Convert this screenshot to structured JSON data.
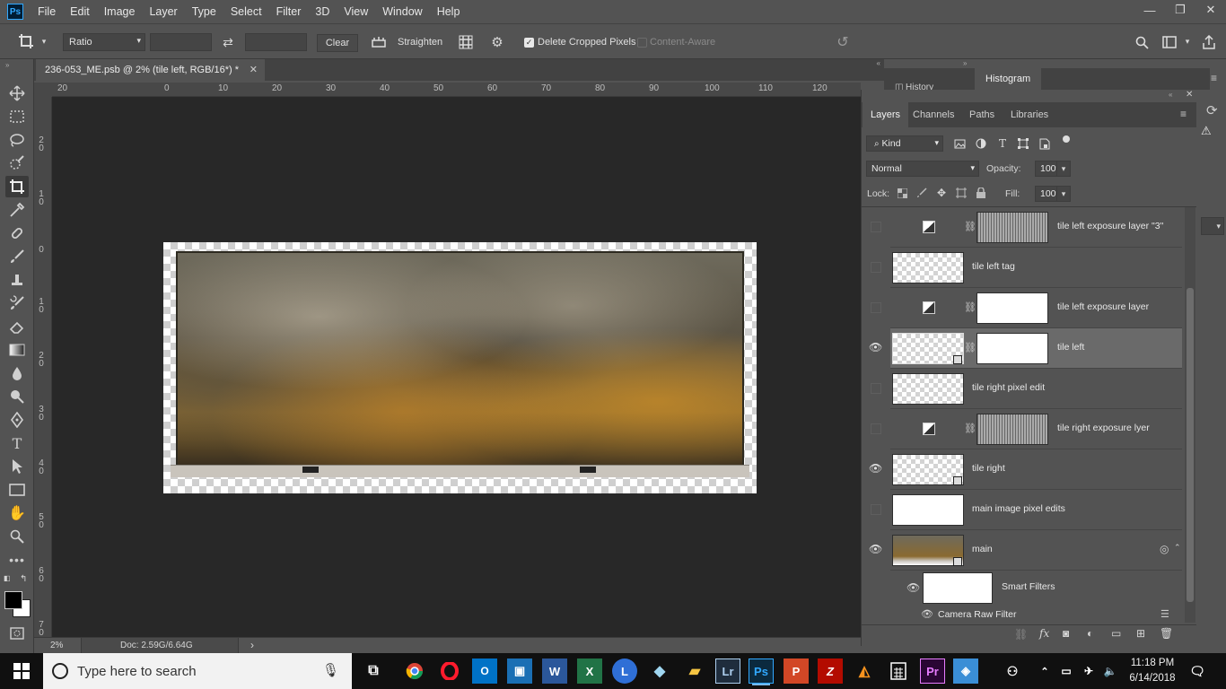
{
  "app": {
    "logo": "Ps",
    "menus": [
      "File",
      "Edit",
      "Image",
      "Layer",
      "Type",
      "Select",
      "Filter",
      "3D",
      "View",
      "Window",
      "Help"
    ]
  },
  "window_controls": {
    "minimize": "—",
    "restore": "❐",
    "close": "✕"
  },
  "options_bar": {
    "ratio_select": "Ratio",
    "clear_label": "Clear",
    "straighten_label": "Straighten",
    "delete_cropped_label": "Delete Cropped Pixels",
    "content_aware_label": "Content-Aware"
  },
  "document_tab": {
    "title": "236-053_ME.psb @ 2% (tile left, RGB/16*) *",
    "close": "✕"
  },
  "ruler_h": [
    "20",
    "0",
    "10",
    "20",
    "30",
    "40",
    "50",
    "60",
    "70",
    "80",
    "90",
    "100",
    "110",
    "120"
  ],
  "ruler_v": [
    "2 0",
    "1 0",
    "0",
    "1 0",
    "2 0",
    "3 0",
    "4 0",
    "5 0",
    "6 0",
    "7 0"
  ],
  "status": {
    "zoom": "2%",
    "doc": "Doc: 2.59G/6.64G",
    "arrow": "›"
  },
  "collapsed_panels": {
    "history": "History",
    "histogram": "Histogram"
  },
  "layers_panel": {
    "tabs": [
      "Layers",
      "Channels",
      "Paths",
      "Libraries"
    ],
    "filter_kind": "Kind",
    "blend_mode": "Normal",
    "opacity_label": "Opacity:",
    "opacity_value": "100%",
    "lock_label": "Lock:",
    "fill_label": "Fill:",
    "fill_value": "100%",
    "layers": [
      {
        "name": "tile left exposure layer \"3\"",
        "visible": false
      },
      {
        "name": "tile left tag",
        "visible": false
      },
      {
        "name": "tile left exposure layer",
        "visible": false
      },
      {
        "name": "tile left",
        "visible": true,
        "selected": true
      },
      {
        "name": "tile right pixel edit",
        "visible": false
      },
      {
        "name": "tile right exposure lyer",
        "visible": false
      },
      {
        "name": "tile right",
        "visible": true
      },
      {
        "name": "main image pixel edits",
        "visible": false
      },
      {
        "name": "main",
        "visible": true
      }
    ],
    "smart_filters": "Smart Filters",
    "camera_raw_filter": "Camera Raw Filter"
  },
  "taskbar": {
    "search_placeholder": "Type here to search",
    "apps": [
      "Ps",
      "Lr",
      "Pr",
      "W",
      "X"
    ],
    "time": "11:18 PM",
    "date": "6/14/2018"
  },
  "colors": {
    "ui_bg": "#535353",
    "canvas_bg": "#282828",
    "selected_layer": "#6a6a6a",
    "taskbar": "#101010"
  }
}
